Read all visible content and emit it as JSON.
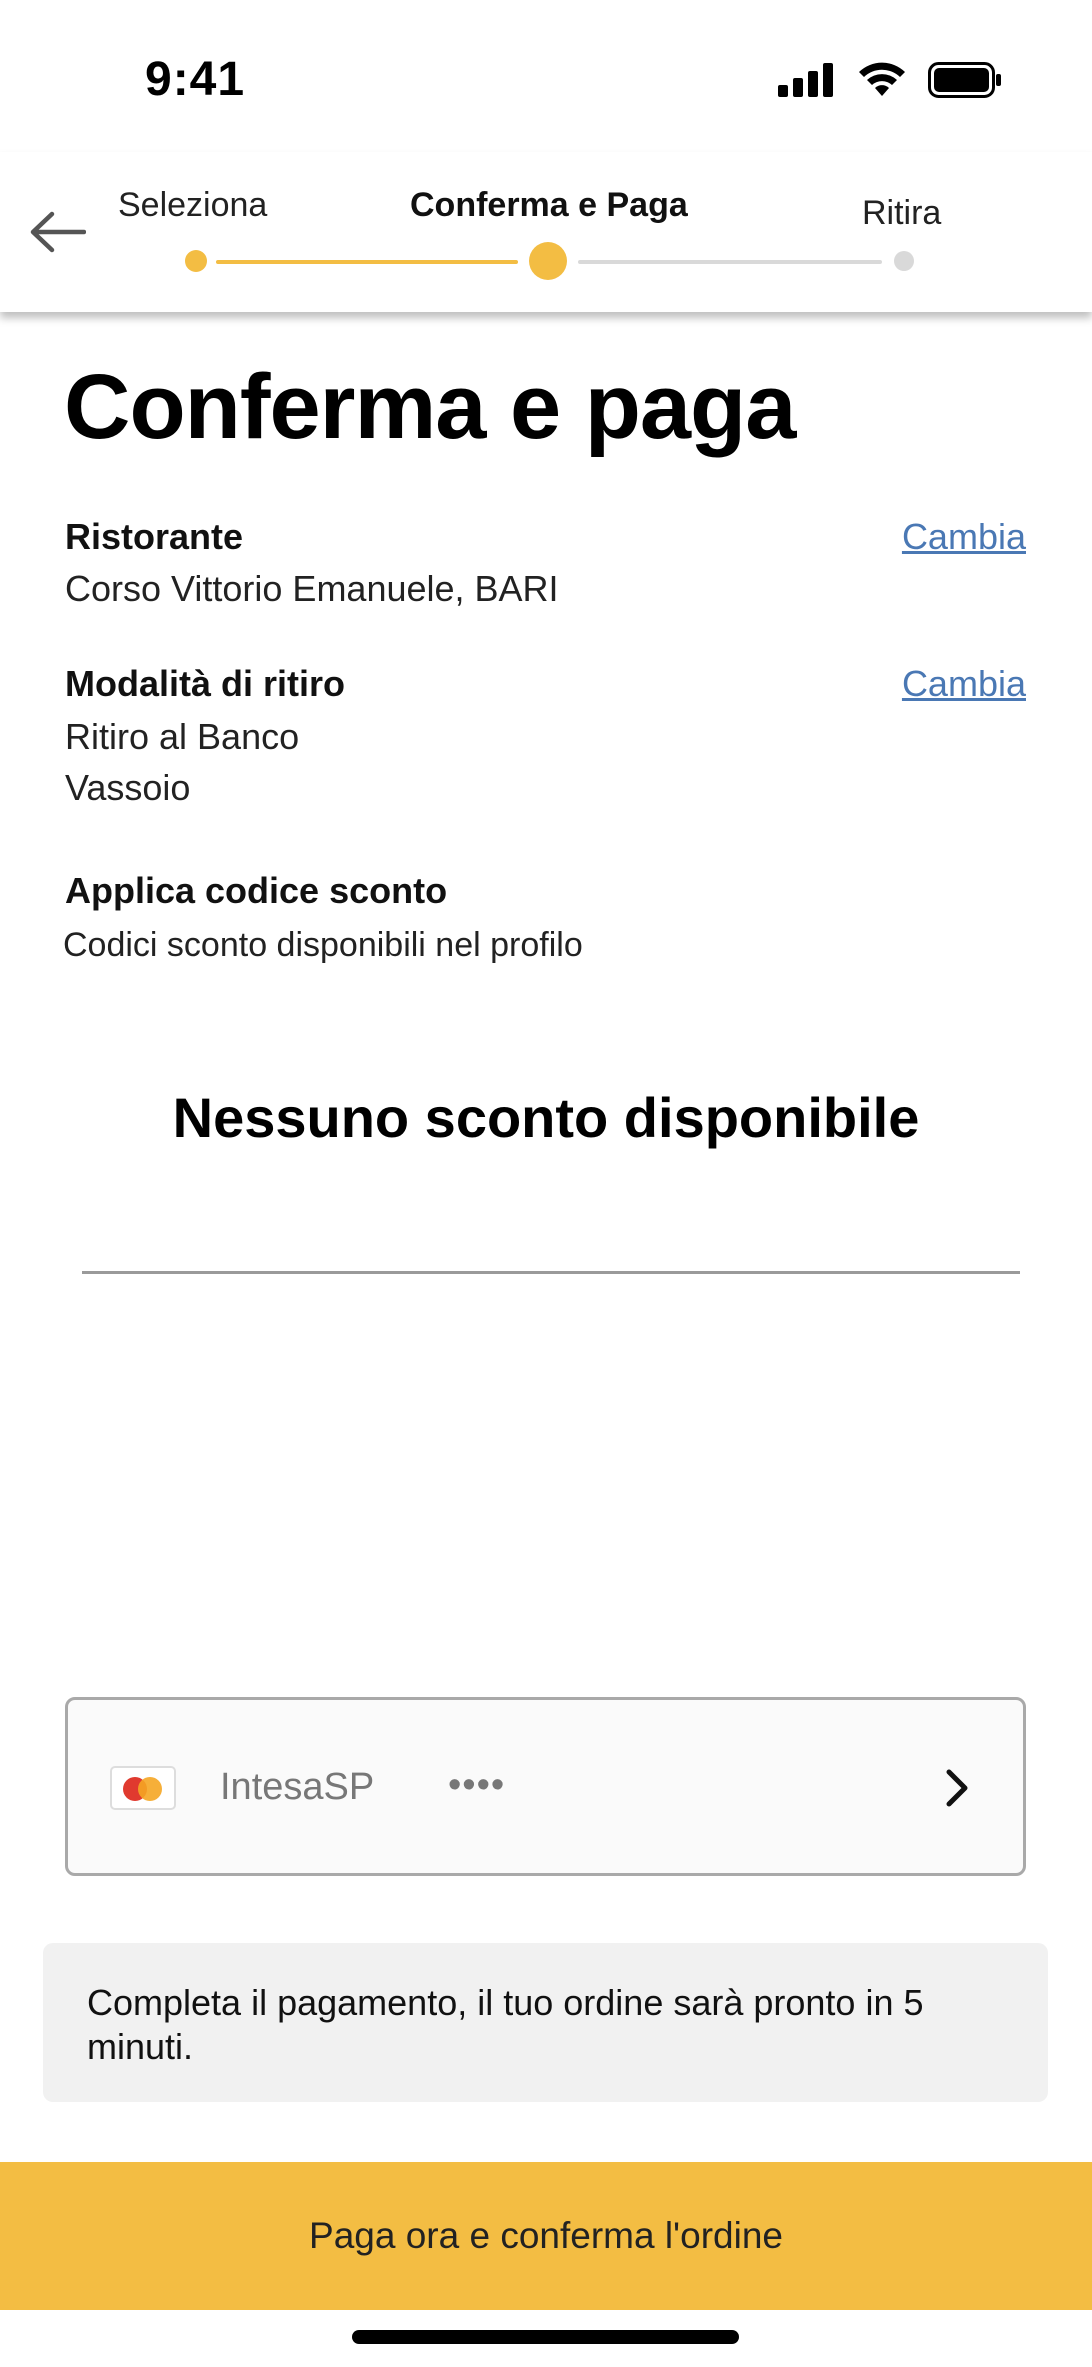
{
  "status_bar": {
    "time": "9:41"
  },
  "header": {
    "steps": [
      {
        "label": "Seleziona",
        "state": "done"
      },
      {
        "label": "Conferma e Paga",
        "state": "active"
      },
      {
        "label": "Ritira",
        "state": "pending"
      }
    ],
    "accent_color": "#f3bd43",
    "inactive_color": "#d9d9d9"
  },
  "main": {
    "title": "Conferma e paga",
    "restaurant": {
      "label": "Ristorante",
      "value": "Corso Vittorio Emanuele, BARI",
      "change_label": "Cambia"
    },
    "pickup": {
      "label": "Modalità di ritiro",
      "value_line1": "Ritiro al Banco",
      "value_line2": "Vassoio",
      "change_label": "Cambia"
    },
    "discount": {
      "label": "Applica codice sconto",
      "subtitle": "Codici sconto disponibili nel profilo",
      "empty_message": "Nessuno sconto disponibile"
    },
    "payment": {
      "card_name": "IntesaSP",
      "card_mask": "••••",
      "card_brand_icon": "mastercard-icon"
    },
    "info_message": "Completa il pagamento, il tuo ordine sarà pronto in 5 minuti.",
    "pay_button_label": "Paga ora e conferma l'ordine"
  }
}
